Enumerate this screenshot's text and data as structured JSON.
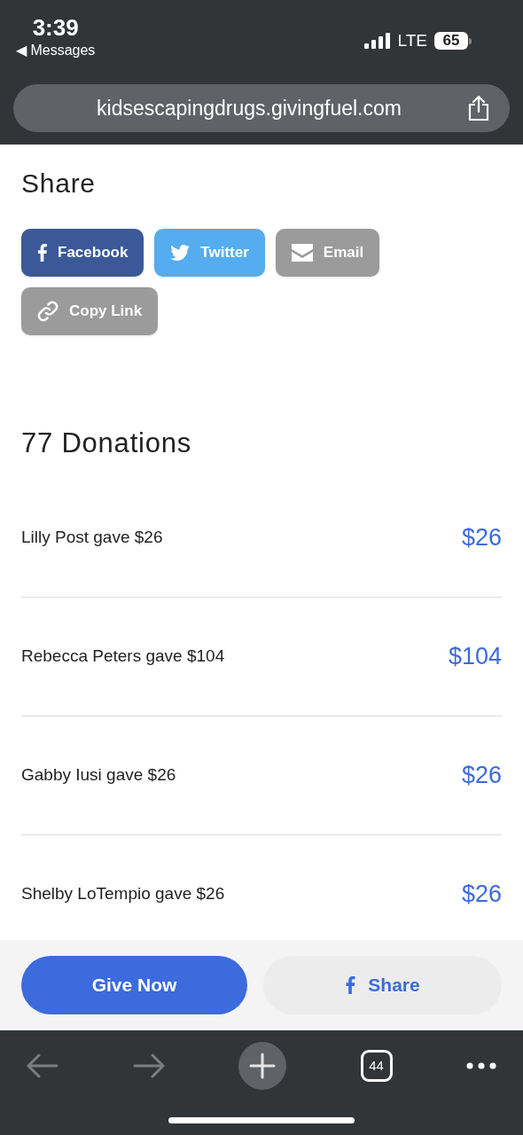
{
  "status_bar": {
    "time": "3:39",
    "back_app": "◀ Messages",
    "network": "LTE",
    "battery": "65"
  },
  "address_bar": {
    "url": "kidsescapingdrugs.givingfuel.com"
  },
  "share": {
    "title": "Share",
    "buttons": [
      {
        "kind": "facebook",
        "label": "Facebook",
        "color": "#3b5998"
      },
      {
        "kind": "twitter",
        "label": "Twitter",
        "color": "#55acee"
      },
      {
        "kind": "email",
        "label": "Email",
        "color": "#9b9b9b"
      },
      {
        "kind": "link",
        "label": "Copy Link",
        "color": "#9b9b9b"
      }
    ]
  },
  "donations": {
    "title": "77 Donations",
    "items": [
      {
        "text": "Lilly Post gave $26",
        "amount": "$26"
      },
      {
        "text": "Rebecca Peters gave $104",
        "amount": "$104"
      },
      {
        "text": "Gabby Iusi gave $26",
        "amount": "$26"
      },
      {
        "text": "Shelby LoTempio gave $26",
        "amount": "$26"
      }
    ]
  },
  "action_bar": {
    "give": "Give Now",
    "share": "Share"
  },
  "toolbar": {
    "tabs_count": "44"
  }
}
